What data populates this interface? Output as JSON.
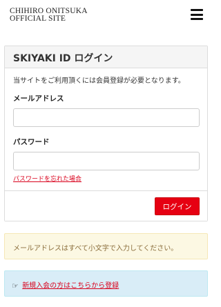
{
  "header": {
    "logo_line1": "CHIHIRO ONITSUKA",
    "logo_line2": "OFFICIAL SITE",
    "menu_icon": "hamburger-menu-icon"
  },
  "login_panel": {
    "title": "SKIYAKI ID ログイン",
    "note": "当サイトをご利用頂くには会員登録が必要となります。",
    "email_label": "メールアドレス",
    "email_value": "",
    "password_label": "パスワード",
    "password_value": "",
    "forgot_link": "パスワードを忘れた場合",
    "login_button": "ログイン",
    "accent_color": "#e60012"
  },
  "warning_alert": {
    "text": "メールアドレスはすべて小文字で入力してください。"
  },
  "info_alert": {
    "icon": "hand-pointing-right-icon",
    "link_text": "新規入会の方はこちらから登録"
  }
}
